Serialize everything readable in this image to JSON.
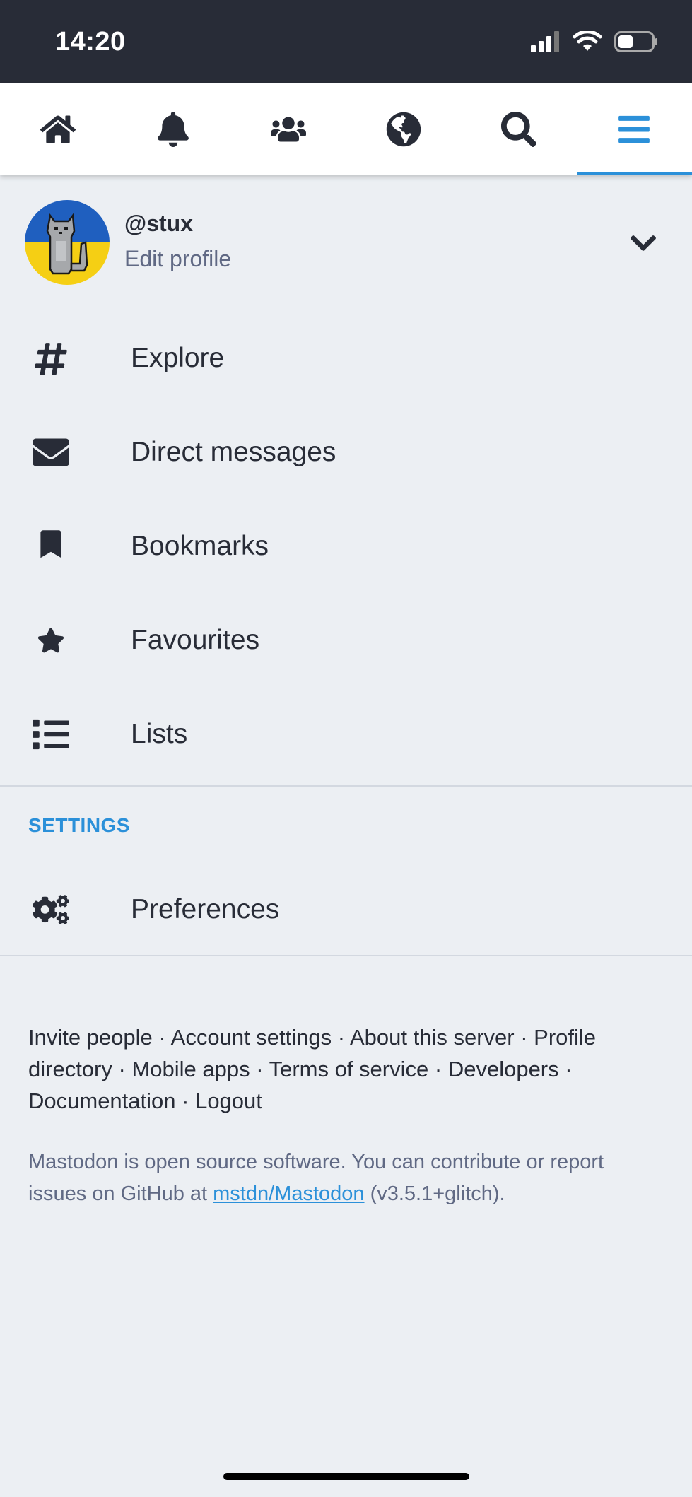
{
  "status_bar": {
    "time": "14:20"
  },
  "tabs": [
    {
      "name": "home",
      "icon": "home-icon"
    },
    {
      "name": "notifications",
      "icon": "bell-icon"
    },
    {
      "name": "local",
      "icon": "users-icon"
    },
    {
      "name": "federated",
      "icon": "globe-icon"
    },
    {
      "name": "search",
      "icon": "search-icon"
    },
    {
      "name": "menu",
      "icon": "bars-icon",
      "active": true
    }
  ],
  "account": {
    "handle": "@stux",
    "edit_label": "Edit profile"
  },
  "menu": {
    "items": [
      {
        "label": "Explore",
        "icon": "hashtag-icon"
      },
      {
        "label": "Direct messages",
        "icon": "envelope-icon"
      },
      {
        "label": "Bookmarks",
        "icon": "bookmark-icon"
      },
      {
        "label": "Favourites",
        "icon": "star-icon"
      },
      {
        "label": "Lists",
        "icon": "list-icon"
      }
    ],
    "settings_heading": "SETTINGS",
    "settings_items": [
      {
        "label": "Preferences",
        "icon": "cogs-icon"
      }
    ]
  },
  "footer": {
    "links": [
      "Invite people",
      "Account settings",
      "About this server",
      "Profile directory",
      "Mobile apps",
      "Terms of service",
      "Developers",
      "Documentation",
      "Logout"
    ],
    "separator": " · ",
    "note_prefix": "Mastodon is open source software. You can contribute or report issues on GitHub at ",
    "repo_link": "mstdn/Mastodon",
    "version": " (v3.5.1+glitch)."
  },
  "colors": {
    "accent": "#2b90d9",
    "status_bar": "#282c37",
    "background": "#eceff3",
    "text": "#282c37",
    "muted": "#606984"
  }
}
